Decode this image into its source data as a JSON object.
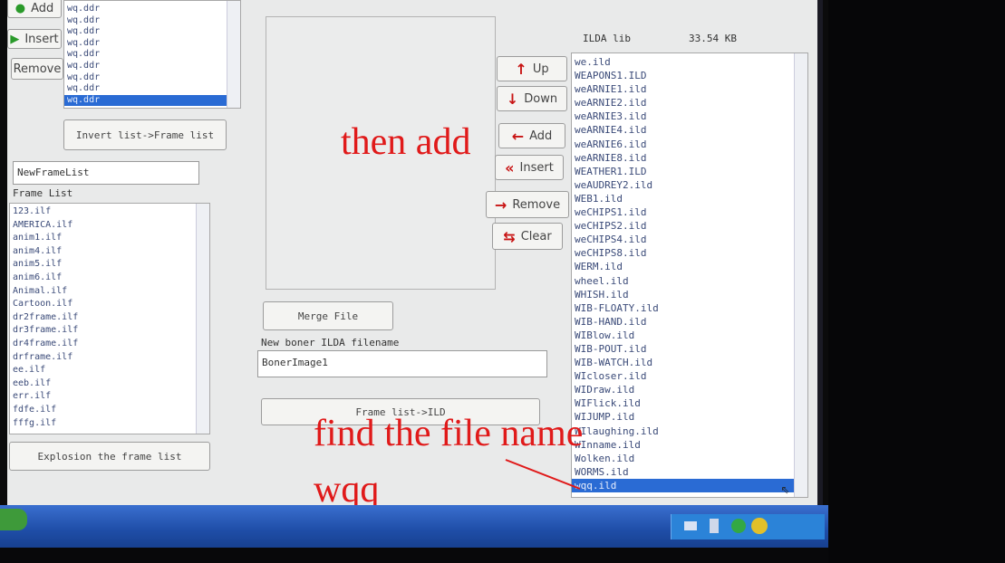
{
  "left_top_buttons": {
    "add": "Add",
    "insert": "Insert",
    "remove": "Remove"
  },
  "source_list": {
    "items": [
      "wq.ddr",
      "wq.ddr",
      "wq.ddr",
      "wq.ddr",
      "wq.ddr",
      "wq.ddr",
      "wq.ddr",
      "wq.ddr",
      "wq.ddr"
    ],
    "selected_index": 8
  },
  "invert_button": "Invert list->Frame list",
  "new_frame_list_value": "NewFrameList",
  "frame_list_label": "Frame List",
  "frame_list": [
    "123.ilf",
    "AMERICA.ilf",
    "anim1.ilf",
    "anim4.ilf",
    "anim5.ilf",
    "anim6.ilf",
    "Animal.ilf",
    "Cartoon.ilf",
    "dr2frame.ilf",
    "dr3frame.ilf",
    "dr4frame.ilf",
    "drframe.ilf",
    "ee.ilf",
    "eeb.ilf",
    "err.ilf",
    "fdfe.ilf",
    "fffg.ilf"
  ],
  "explosion_button": "Explosion the frame list",
  "merge_button": "Merge File",
  "new_ilda_label": "New boner ILDA filename",
  "new_ilda_value": "BonerImage1",
  "frame_to_ild_button": "Frame list->ILD",
  "middle_buttons": {
    "up": "Up",
    "down": "Down",
    "add": "Add",
    "insert": "Insert",
    "remove": "Remove",
    "clear": "Clear"
  },
  "ilda_header": {
    "label": "ILDA lib",
    "size": "33.54 KB"
  },
  "ilda_list": [
    "we.ild",
    "WEAPONS1.ILD",
    "weARNIE1.ild",
    "weARNIE2.ild",
    "weARNIE3.ild",
    "weARNIE4.ild",
    "weARNIE6.ild",
    "weARNIE8.ild",
    "WEATHER1.ILD",
    "weAUDREY2.ild",
    "WEB1.ild",
    "weCHIPS1.ild",
    "weCHIPS2.ild",
    "weCHIPS4.ild",
    "weCHIPS8.ild",
    "WERM.ild",
    "wheel.ild",
    "WHISH.ild",
    "WIB-FLOATY.ild",
    "WIB-HAND.ild",
    "WIBlow.ild",
    "WIB-POUT.ild",
    "WIB-WATCH.ild",
    "WIcloser.ild",
    "WIDraw.ild",
    "WIFlick.ild",
    "WIJUMP.ild",
    "WIlaughing.ild",
    "WInname.ild",
    "Wolken.ild",
    "WORMS.ild",
    "wqq.ild"
  ],
  "ilda_selected_index": 31,
  "annotations": {
    "then_add": "then add",
    "find_file": "find the file name",
    "wqq": "wqq"
  },
  "colors": {
    "annotation": "#e01a1a",
    "selection": "#2a6bd4",
    "taskbar": "#1f4ea8"
  }
}
